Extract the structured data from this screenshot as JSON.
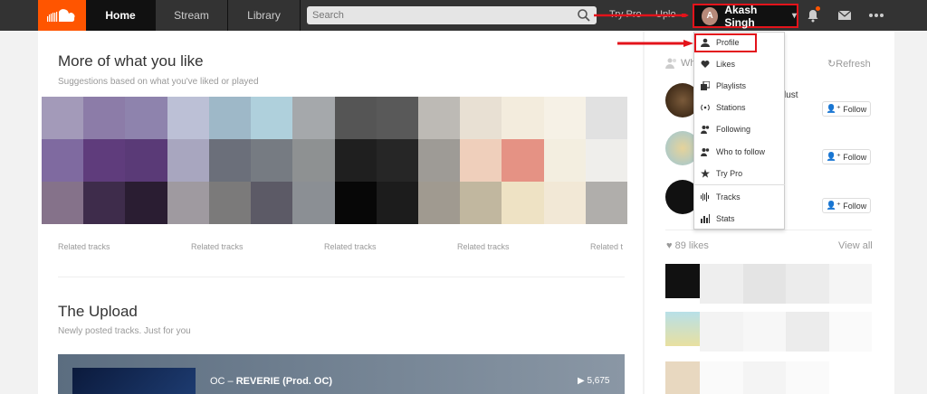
{
  "header": {
    "nav": {
      "home": "Home",
      "stream": "Stream",
      "library": "Library"
    },
    "search_placeholder": "Search",
    "try_pro": "Try Pro",
    "upload": "Uplo",
    "user": {
      "initial": "A",
      "name": "Akash Singh"
    }
  },
  "main": {
    "section1": {
      "title": "More of what you like",
      "subtitle": "Suggestions based on what you've liked or played"
    },
    "related_labels": [
      "Related tracks",
      "Related tracks",
      "Related tracks",
      "Related tracks",
      "Related t"
    ],
    "section2": {
      "title": "The Upload",
      "subtitle": "Newly posted tracks. Just for you"
    },
    "upload_track": {
      "artist": "OC",
      "separator": " – ",
      "title": "REVERIE (Prod. OC)",
      "plays": "5,675"
    }
  },
  "sidebar": {
    "who_prefix": "Wh",
    "refresh": "Refresh",
    "partial_text": "lust",
    "follow_label": "Follow",
    "likes": "89 likes",
    "view_all": "View all"
  },
  "dropdown": {
    "items": [
      "Profile",
      "Likes",
      "Playlists",
      "Stations",
      "Following",
      "Who to follow",
      "Try Pro",
      "Tracks",
      "Stats"
    ]
  },
  "colors": {
    "brand": "#ff5500",
    "highlight": "#e3131b",
    "header_bg": "#333333"
  }
}
